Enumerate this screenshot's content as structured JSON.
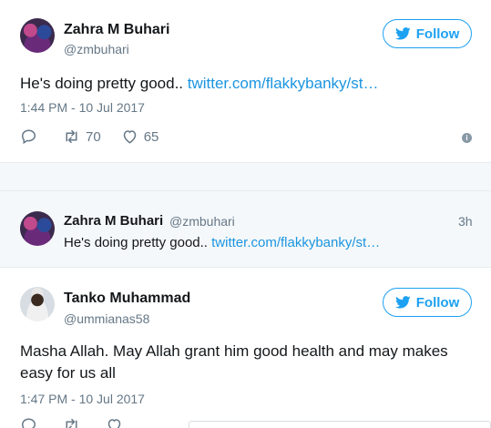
{
  "tweet1": {
    "name": "Zahra M Buhari",
    "handle": "@zmbuhari",
    "follow_label": "Follow",
    "text": "He's doing pretty good.. ",
    "link": "twitter.com/flakkybanky/st…",
    "timestamp": "1:44 PM - 10 Jul 2017",
    "retweets": "70",
    "likes": "65"
  },
  "quoted": {
    "name": "Zahra M Buhari",
    "handle": "@zmbuhari",
    "time": "3h",
    "text": "He's doing pretty good.. ",
    "link": "twitter.com/flakkybanky/st…"
  },
  "tweet2": {
    "name": "Tanko Muhammad",
    "handle": "@ummianas58",
    "follow_label": "Follow",
    "text_line1": "Masha Allah. May Allah grant him good health and may makes",
    "text_line2": "easy for us all",
    "timestamp": "1:47 PM - 10 Jul 2017"
  },
  "icons": {
    "follow": "twitter-bird-icon",
    "reply": "reply-icon",
    "retweet": "retweet-icon",
    "like": "heart-icon",
    "info": "info-icon"
  },
  "colors": {
    "accent": "#1da1f2",
    "link": "#1b95e0",
    "muted": "#657786",
    "separator": "#f5f8fa"
  }
}
